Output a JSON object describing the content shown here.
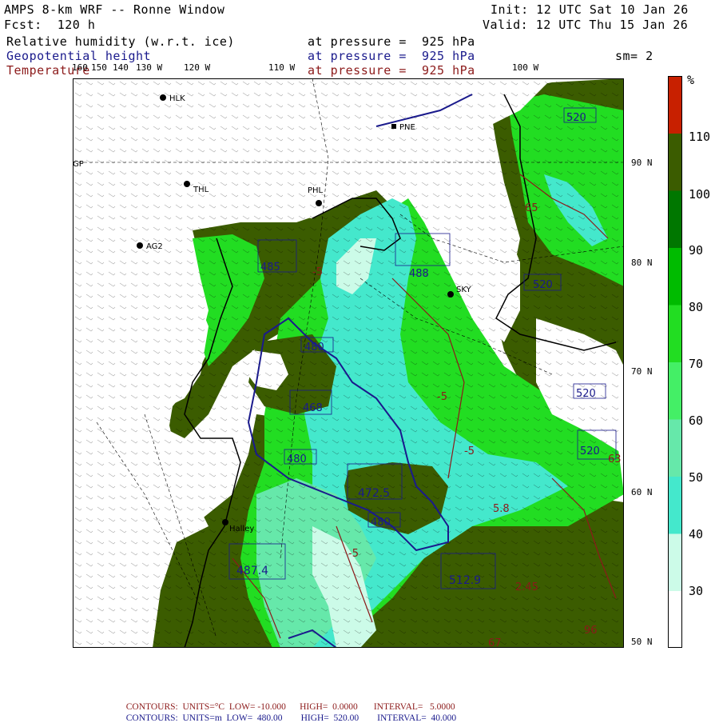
{
  "header": {
    "title": "AMPS 8-km WRF -- Ronne Window",
    "init": "Init: 12 UTC Sat 10 Jan 26",
    "fcst": "Fcst:  120 h",
    "valid": "Valid: 12 UTC Thu 15 Jan 26",
    "fields": [
      {
        "name": "Relative humidity (w.r.t. ice)",
        "level": "at pressure =  925 hPa"
      },
      {
        "name": "Geopotential height",
        "level": "at pressure =  925 hPa"
      },
      {
        "name": "Temperature",
        "level": "at pressure =  925 hPa"
      }
    ],
    "smoothing": "sm= 2"
  },
  "colors": {
    "rh_field": "#1a1a1a",
    "height_contour": "#1a1a8c",
    "temp_contour": "#8c1a1a"
  },
  "lon_labels": [
    "160",
    "150",
    "140",
    "130 W",
    "120 W",
    "110 W",
    "100 W"
  ],
  "lat_labels": [
    "90 N",
    "80 N",
    "70 N",
    "60 N",
    "50 N"
  ],
  "stations": [
    {
      "name": "HLK"
    },
    {
      "name": "PNE"
    },
    {
      "name": "THL"
    },
    {
      "name": "PHL"
    },
    {
      "name": "AG2"
    },
    {
      "name": "SKY"
    },
    {
      "name": "Halley"
    }
  ],
  "map_labels": {
    "gp": "GP",
    "L1": "488",
    "L2": "485",
    "L3": "472.5",
    "L4": "487.4",
    "L5": "468",
    "H1": "512.9",
    "H2": "2.45",
    "H3": "65",
    "H4": "67",
    "H5": "96",
    "c480a": "480",
    "c480b": "480",
    "c480c": "480",
    "c520a": "520",
    "c520b": "520",
    "c520c": "520",
    "c520d": "520",
    "c5a": "-5",
    "c5b": "-5",
    "c5c": "-5",
    "c5d": "-5",
    "val63": "63",
    "v58": "5.8"
  },
  "colorbar": {
    "unit": "%",
    "ticks": [
      "110",
      "100",
      "90",
      "80",
      "70",
      "60",
      "50",
      "40",
      "30"
    ],
    "colors": [
      "#ffffff",
      "#ccfbe8",
      "#44e8cc",
      "#66e8aa",
      "#44ef66",
      "#22dd22",
      "#00bb00",
      "#007700",
      "#3b5c00",
      "#c82000"
    ]
  },
  "footer": {
    "line1": {
      "label": "CONTOURS:",
      "units": "UNITS=°C",
      "low": "LOW= -10.000",
      "high": "HIGH=  0.0000",
      "interval": "INTERVAL=   5.0000"
    },
    "line2": {
      "label": "CONTOURS:",
      "units": "UNITS=m",
      "low": "LOW=  480.00",
      "high": "HIGH=  520.00",
      "interval": "INTERVAL=  40.000"
    }
  }
}
